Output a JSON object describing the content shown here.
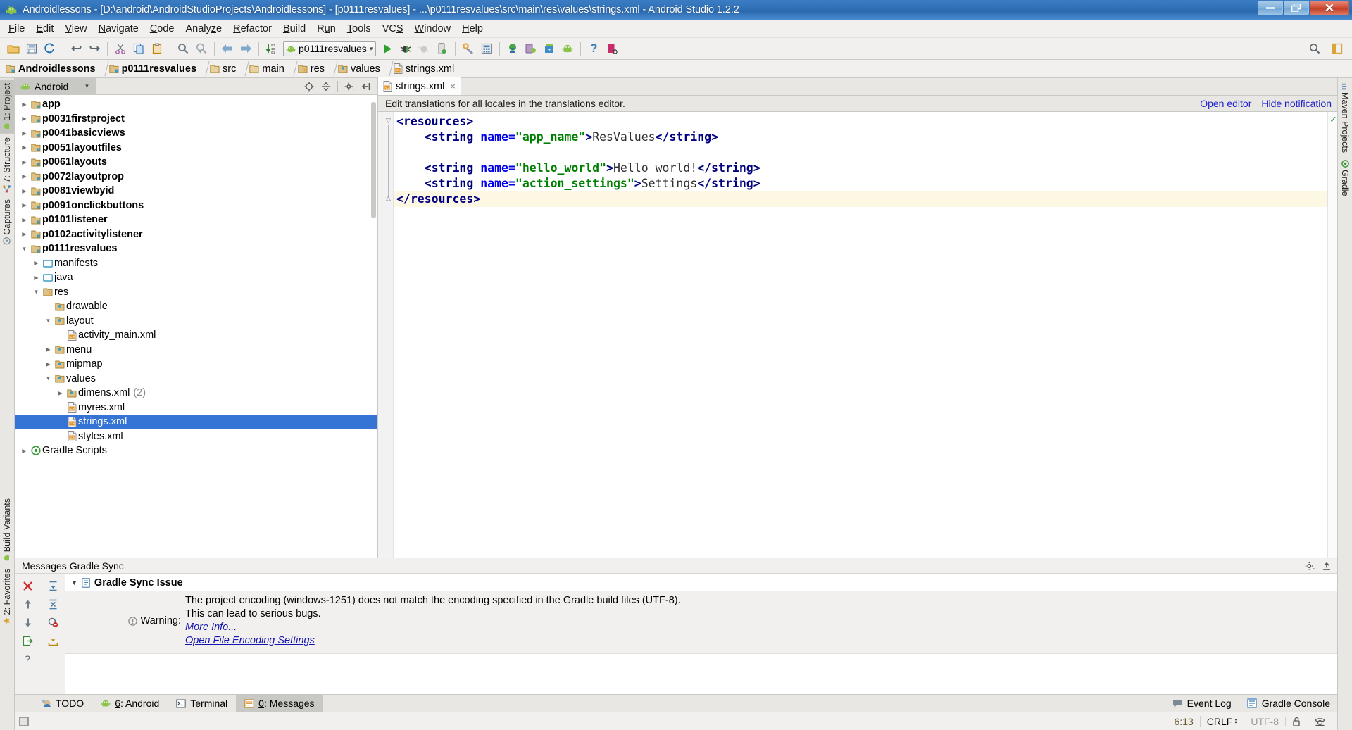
{
  "window": {
    "title": "Androidlessons - [D:\\android\\AndroidStudioProjects\\Androidlessons] - [p0111resvalues] - ...\\p0111resvalues\\src\\main\\res\\values\\strings.xml - Android Studio 1.2.2",
    "app_icon": "android-robot-icon",
    "minimize_label": "–",
    "restore_label": "❐",
    "close_label": "✕"
  },
  "menubar": [
    {
      "pre": "",
      "u": "F",
      "post": "ile"
    },
    {
      "pre": "",
      "u": "E",
      "post": "dit"
    },
    {
      "pre": "",
      "u": "V",
      "post": "iew"
    },
    {
      "pre": "",
      "u": "N",
      "post": "avigate"
    },
    {
      "pre": "",
      "u": "C",
      "post": "ode"
    },
    {
      "pre": "Analy",
      "u": "z",
      "post": "e"
    },
    {
      "pre": "",
      "u": "R",
      "post": "efactor"
    },
    {
      "pre": "",
      "u": "B",
      "post": "uild"
    },
    {
      "pre": "R",
      "u": "u",
      "post": "n"
    },
    {
      "pre": "",
      "u": "T",
      "post": "ools"
    },
    {
      "pre": "VC",
      "u": "S",
      "post": ""
    },
    {
      "pre": "",
      "u": "W",
      "post": "indow"
    },
    {
      "pre": "",
      "u": "H",
      "post": "elp"
    }
  ],
  "toolbar": {
    "buttons": [
      "open-folder-icon",
      "save-all-icon",
      "sync-refresh-icon",
      "undo-icon",
      "redo-icon",
      "cut-icon",
      "copy-icon",
      "paste-icon",
      "find-icon",
      "find-replace-icon",
      "back-icon",
      "forward-icon",
      "sort-numeric-icon"
    ],
    "run_config": {
      "icon": "android-robot-icon",
      "label": "p0111resvalues",
      "caret": "▾"
    },
    "buttons2": [
      "run-icon",
      "debug-icon",
      "debug-disabled-icon",
      "device-debug-icon",
      "wrench-icon",
      "avd-manager-icon",
      "sdk-sync-icon",
      "device-monitor-icon",
      "sdk-manager-icon",
      "android-icon",
      "help-icon",
      "device-screenshot-icon"
    ],
    "right_buttons": [
      "search-everywhere-icon",
      "layout-toggle-icon"
    ]
  },
  "breadcrumb": [
    {
      "label": "Androidlessons",
      "icon": "module-folder-icon",
      "bold": true
    },
    {
      "label": "p0111resvalues",
      "icon": "module-folder-icon",
      "bold": true
    },
    {
      "label": "src",
      "icon": "folder-icon",
      "bold": false
    },
    {
      "label": "main",
      "icon": "folder-icon",
      "bold": false
    },
    {
      "label": "res",
      "icon": "res-folder-icon",
      "bold": false
    },
    {
      "label": "values",
      "icon": "values-folder-icon",
      "bold": false
    },
    {
      "label": "strings.xml",
      "icon": "xml-file-icon",
      "bold": false
    }
  ],
  "left_strip": [
    {
      "label": "1: Project",
      "underline_index": 0,
      "icon": "android-robot-icon",
      "active": true
    },
    {
      "label": "7: Structure",
      "underline_index": 0,
      "icon": "structure-icon",
      "active": false
    },
    {
      "label": "Captures",
      "underline_index": -1,
      "icon": "captures-icon",
      "active": false
    }
  ],
  "left_strip_bottom": [
    {
      "label": "Build Variants",
      "icon": "build-variants-icon"
    },
    {
      "label": "2: Favorites",
      "icon": "favorites-star-icon"
    }
  ],
  "right_strip": [
    {
      "label": "Maven Projects",
      "icon": "maven-m-icon"
    },
    {
      "label": "Gradle",
      "icon": "gradle-icon"
    }
  ],
  "project_panel": {
    "tab_label": "Android",
    "tab_icon": "android-robot-icon",
    "tab_caret": "▾",
    "actions": [
      "target-locate-icon",
      "collapse-all-icon",
      "gear-icon",
      "hide-panel-icon"
    ],
    "tree": [
      {
        "label": "app",
        "indent": 0,
        "arrow": "closed",
        "icon": "module-folder-icon",
        "bold": true
      },
      {
        "label": "p0031firstproject",
        "indent": 0,
        "arrow": "closed",
        "icon": "module-folder-icon",
        "bold": true
      },
      {
        "label": "p0041basicviews",
        "indent": 0,
        "arrow": "closed",
        "icon": "module-folder-icon",
        "bold": true
      },
      {
        "label": "p0051layoutfiles",
        "indent": 0,
        "arrow": "closed",
        "icon": "module-folder-icon",
        "bold": true
      },
      {
        "label": "p0061layouts",
        "indent": 0,
        "arrow": "closed",
        "icon": "module-folder-icon",
        "bold": true
      },
      {
        "label": "p0072layoutprop",
        "indent": 0,
        "arrow": "closed",
        "icon": "module-folder-icon",
        "bold": true
      },
      {
        "label": "p0081viewbyid",
        "indent": 0,
        "arrow": "closed",
        "icon": "module-folder-icon",
        "bold": true
      },
      {
        "label": "p0091onclickbuttons",
        "indent": 0,
        "arrow": "closed",
        "icon": "module-folder-icon",
        "bold": true
      },
      {
        "label": "p0101listener",
        "indent": 0,
        "arrow": "closed",
        "icon": "module-folder-icon",
        "bold": true
      },
      {
        "label": "p0102activitylistener",
        "indent": 0,
        "arrow": "closed",
        "icon": "module-folder-icon",
        "bold": true
      },
      {
        "label": "p0111resvalues",
        "indent": 0,
        "arrow": "open",
        "icon": "module-folder-icon",
        "bold": true
      },
      {
        "label": "manifests",
        "indent": 1,
        "arrow": "closed",
        "icon": "manifests-folder-icon",
        "bold": false
      },
      {
        "label": "java",
        "indent": 1,
        "arrow": "closed",
        "icon": "java-folder-icon",
        "bold": false
      },
      {
        "label": "res",
        "indent": 1,
        "arrow": "open",
        "icon": "res-folder-icon",
        "bold": false
      },
      {
        "label": "drawable",
        "indent": 2,
        "arrow": "none",
        "icon": "values-folder-icon",
        "bold": false
      },
      {
        "label": "layout",
        "indent": 2,
        "arrow": "open",
        "icon": "values-folder-icon",
        "bold": false
      },
      {
        "label": "activity_main.xml",
        "indent": 3,
        "arrow": "none",
        "icon": "xml-file-icon",
        "bold": false
      },
      {
        "label": "menu",
        "indent": 2,
        "arrow": "closed",
        "icon": "values-folder-icon",
        "bold": false
      },
      {
        "label": "mipmap",
        "indent": 2,
        "arrow": "closed",
        "icon": "values-folder-icon",
        "bold": false
      },
      {
        "label": "values",
        "indent": 2,
        "arrow": "open",
        "icon": "values-folder-icon",
        "bold": false
      },
      {
        "label": "dimens.xml",
        "indent": 3,
        "arrow": "closed",
        "icon": "values-folder-icon",
        "bold": false,
        "count": "(2)"
      },
      {
        "label": "myres.xml",
        "indent": 3,
        "arrow": "none",
        "icon": "xml-file-icon",
        "bold": false
      },
      {
        "label": "strings.xml",
        "indent": 3,
        "arrow": "none",
        "icon": "xml-file-icon",
        "bold": false,
        "selected": true
      },
      {
        "label": "styles.xml",
        "indent": 3,
        "arrow": "none",
        "icon": "xml-file-icon",
        "bold": false
      },
      {
        "label": "Gradle Scripts",
        "indent": 0,
        "arrow": "closed",
        "icon": "gradle-icon",
        "bold": false
      }
    ]
  },
  "editor": {
    "tab": {
      "label": "strings.xml",
      "icon": "xml-file-icon",
      "close": "×"
    },
    "notification": {
      "text": "Edit translations for all locales in the translations editor.",
      "open_editor": "Open editor",
      "hide_notification": "Hide notification"
    },
    "code_lines": [
      [
        {
          "t": "punct",
          "v": "<"
        },
        {
          "t": "tag",
          "v": "resources"
        },
        {
          "t": "punct",
          "v": ">"
        }
      ],
      [
        {
          "t": "text",
          "v": "    "
        },
        {
          "t": "punct",
          "v": "<"
        },
        {
          "t": "tag",
          "v": "string"
        },
        {
          "t": "text",
          "v": " "
        },
        {
          "t": "attr",
          "v": "name="
        },
        {
          "t": "val",
          "v": "\"app_name\""
        },
        {
          "t": "punct",
          "v": ">"
        },
        {
          "t": "text",
          "v": "ResValues"
        },
        {
          "t": "punct",
          "v": "</"
        },
        {
          "t": "tag",
          "v": "string"
        },
        {
          "t": "punct",
          "v": ">"
        }
      ],
      [],
      [
        {
          "t": "text",
          "v": "    "
        },
        {
          "t": "punct",
          "v": "<"
        },
        {
          "t": "tag",
          "v": "string"
        },
        {
          "t": "text",
          "v": " "
        },
        {
          "t": "attr",
          "v": "name="
        },
        {
          "t": "val",
          "v": "\"hello_world\""
        },
        {
          "t": "punct",
          "v": ">"
        },
        {
          "t": "text",
          "v": "Hello world!"
        },
        {
          "t": "punct",
          "v": "</"
        },
        {
          "t": "tag",
          "v": "string"
        },
        {
          "t": "punct",
          "v": ">"
        }
      ],
      [
        {
          "t": "text",
          "v": "    "
        },
        {
          "t": "punct",
          "v": "<"
        },
        {
          "t": "tag",
          "v": "string"
        },
        {
          "t": "text",
          "v": " "
        },
        {
          "t": "attr",
          "v": "name="
        },
        {
          "t": "val",
          "v": "\"action_settings\""
        },
        {
          "t": "punct",
          "v": ">"
        },
        {
          "t": "text",
          "v": "Settings"
        },
        {
          "t": "punct",
          "v": "</"
        },
        {
          "t": "tag",
          "v": "string"
        },
        {
          "t": "punct",
          "v": ">"
        }
      ],
      [
        {
          "t": "punct",
          "v": "</"
        },
        {
          "t": "tag",
          "v": "resources"
        },
        {
          "t": "punct",
          "v": ">"
        }
      ]
    ],
    "highlight_line_index": 5,
    "inspection_ok": "✓"
  },
  "messages": {
    "panel_title": "Messages Gradle Sync",
    "header_actions": [
      "gear-icon",
      "hide-panel-icon"
    ],
    "gutter_buttons": [
      "close-red-x-icon",
      "expand-all-icon",
      "arrow-up-icon",
      "collapse-all-icon",
      "arrow-down-icon",
      "filter-errors-icon",
      "export-icon",
      "download-icon",
      "help-question-icon",
      ""
    ],
    "root_label": "Gradle Sync Issue",
    "root_icon": "info-note-icon",
    "root_tri": "▼",
    "warning_label": "Warning:",
    "warning_icon": "warning-circle-icon",
    "warning_lines": [
      "The project encoding (windows-1251) does not match the encoding specified in the Gradle build files (UTF-8).",
      "This can lead to serious bugs."
    ],
    "warning_links": [
      "More Info...",
      "Open File Encoding Settings"
    ]
  },
  "bottom_tabs": [
    {
      "label": "TODO",
      "underline": "",
      "icon": "todo-icon",
      "active": false
    },
    {
      "label": ": Android",
      "underline": "6",
      "icon": "android-robot-icon",
      "active": false
    },
    {
      "label": "Terminal",
      "underline": "",
      "icon": "terminal-icon",
      "active": false
    },
    {
      "label": ": Messages",
      "underline": "0",
      "icon": "messages-icon",
      "active": true
    }
  ],
  "bottom_right": [
    {
      "label": "Event Log",
      "icon": "event-log-icon"
    },
    {
      "label": "Gradle Console",
      "icon": "gradle-console-icon"
    }
  ],
  "statusbar": {
    "caret_position": "6:13",
    "line_separator": "CRLF",
    "line_separator_caret": "↕",
    "encoding": "UTF-8",
    "lock_icon": "unlocked-icon",
    "inspection_icon": "hector-inspector-icon"
  },
  "colors": {
    "selection_blue": "#3573d4",
    "title_blue": "#2f6fb5",
    "link_blue": "#2222cc",
    "xml_tag": "#000080",
    "xml_attr": "#0000ee",
    "xml_value": "#008000",
    "highlight_yellow": "#fdf8e3",
    "android_green": "#8bc34a"
  }
}
